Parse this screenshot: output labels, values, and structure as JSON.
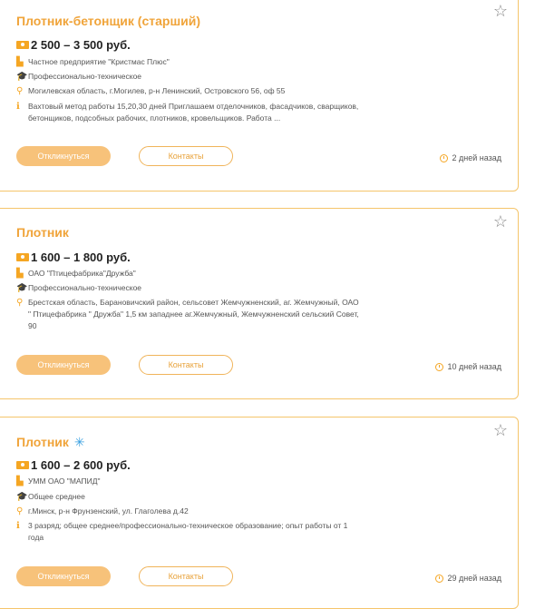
{
  "colors": {
    "accent": "#f0a43a",
    "border": "#f5c56b",
    "snow": "#3aa0e0"
  },
  "buttons": {
    "apply_label": "Откликнуться",
    "contacts_label": "Контакты"
  },
  "vacancies": [
    {
      "title": "Плотник-бетонщик (старший)",
      "salary": "2 500 – 3 500 руб.",
      "company": "Частное предприятие \"Кристмас Плюс\"",
      "education": "Профессионально-техническое",
      "address": "Могилевская область, г.Могилев, р-н Ленинский, Островского 56, оф 55",
      "description": "Вахтовый метод работы 15,20,30 дней Приглашаем отделочников, фасадчиков, сварщиков, бетонщиков, подсобных рабочих, плотников, кровельщиков. Работа ...",
      "posted": "2 дней назад"
    },
    {
      "title": "Плотник",
      "salary": "1 600 – 1 800 руб.",
      "company": "ОАО \"Птицефабрика\"Дружба\"",
      "education": "Профессионально-техническое",
      "address": "Брестская область, Барановичский район, сельсовет Жемчужненский, аг. Жемчужный, ОАО \" Птицефабрика \" Дружба\" 1,5 км западнее аг.Жемчужный, Жемчужненский сельский Совет, 90",
      "posted": "10 дней назад"
    },
    {
      "title": "Плотник",
      "salary": "1 600 – 2 600 руб.",
      "company": "УММ ОАО \"МАПИД\"",
      "education": "Общее среднее",
      "address": "г.Минск, р-н Фрунзенский, ул. Глаголева д.42",
      "description": "3 разряд; общее среднее/профессионально-техническое образование; опыт работы от 1 года",
      "posted": "29 дней назад"
    }
  ]
}
